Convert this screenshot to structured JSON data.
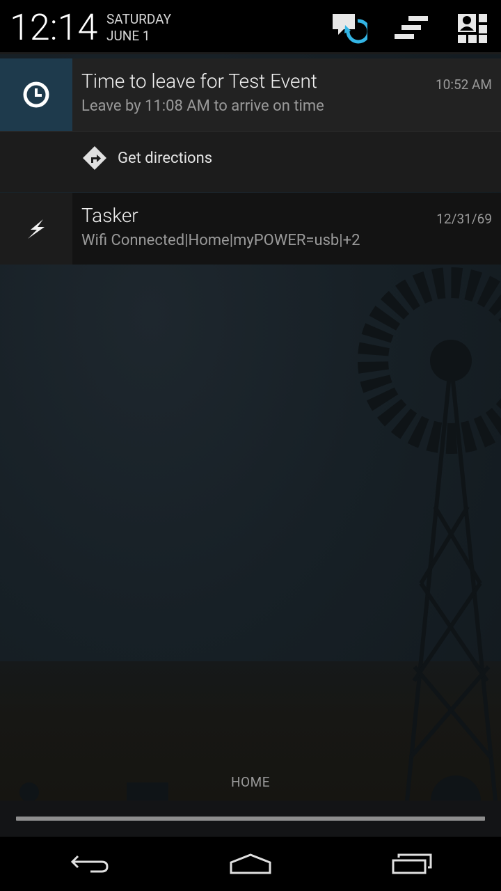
{
  "header": {
    "time": "12:14",
    "day": "SATURDAY",
    "date": "JUNE 1",
    "icons": [
      "quick-settings-sync-icon",
      "notification-clear-icon",
      "quick-settings-icon"
    ]
  },
  "notifications": [
    {
      "icon": "alarm-clock-icon",
      "title": "Time to leave for Test Event",
      "text": "Leave by 11:08 AM to arrive on time",
      "time": "10:52 AM",
      "action": {
        "icon": "directions-icon",
        "label": "Get directions"
      }
    },
    {
      "icon": "lightning-bolt-icon",
      "title": "Tasker",
      "text": "Wifi Connected|Home|myPOWER=usb|+2",
      "time": "12/31/69"
    }
  ],
  "carrier_label": "HOME",
  "colors": {
    "accent": "#33b5e5",
    "calendar_icon_bg": "#1e3a4c",
    "background": "#141a1f"
  },
  "navbar": [
    "back-icon",
    "home-icon",
    "recents-icon"
  ]
}
